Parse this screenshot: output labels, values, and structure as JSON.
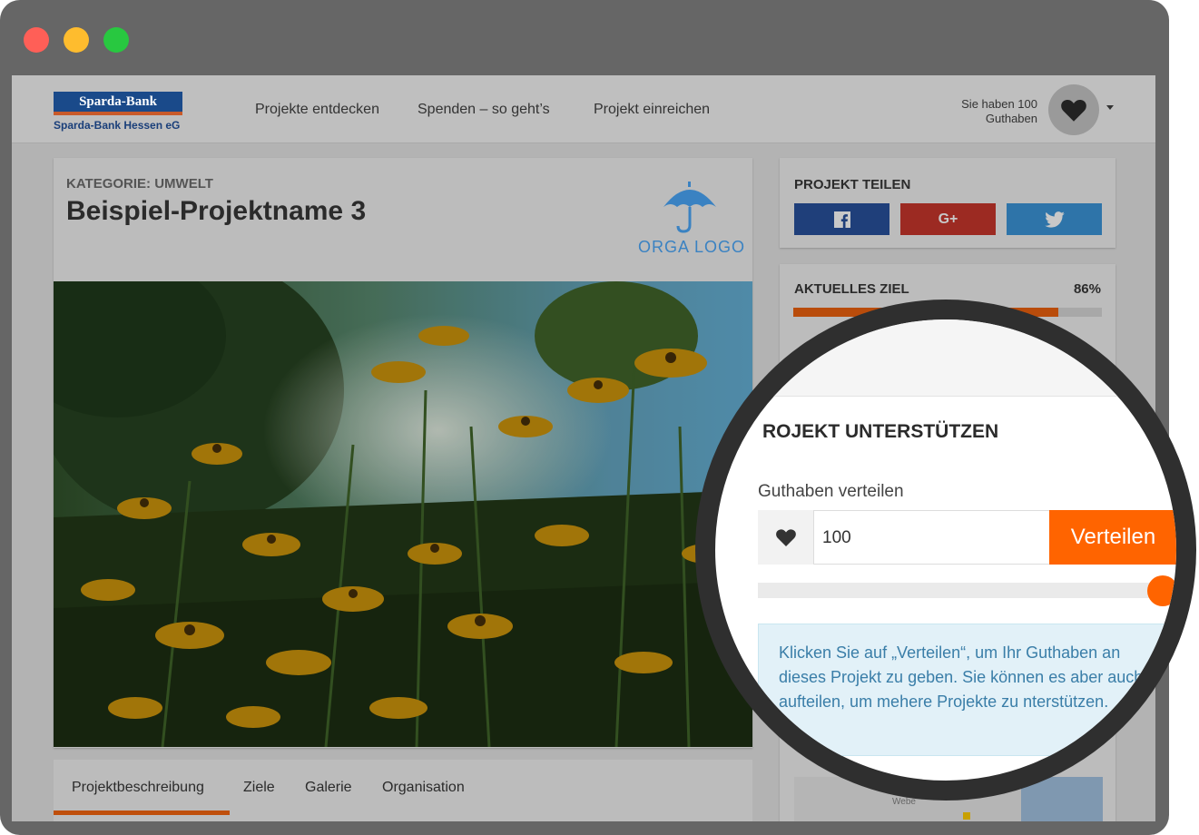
{
  "window": {
    "controls": [
      {
        "name": "close",
        "color": "#ff5f57"
      },
      {
        "name": "minimize",
        "color": "#febc2e"
      },
      {
        "name": "maximize",
        "color": "#28c840"
      }
    ]
  },
  "header": {
    "logo_title": "Sparda-Bank",
    "logo_subtitle": "Sparda-Bank Hessen eG",
    "nav": [
      "Projekte entdecken",
      "Spenden – so geht’s",
      "Projekt einreichen"
    ],
    "credit_line1": "Sie haben 100",
    "credit_line2": "Guthaben",
    "account_icon": "heart-icon"
  },
  "project": {
    "category": "KATEGORIE: UMWELT",
    "title": "Beispiel-Projektname 3",
    "orga_logo_text": "ORGA LOGO",
    "tabs": [
      "Projektbeschreibung",
      "Ziele",
      "Galerie",
      "Organisation"
    ],
    "active_tab": "Projektbeschreibung"
  },
  "sidebar": {
    "share_heading": "PROJEKT TEILEN",
    "share_buttons": [
      {
        "name": "facebook",
        "label": "f",
        "color": "#1f3f7a"
      },
      {
        "name": "google-plus",
        "label": "G+",
        "color": "#9c2a22"
      },
      {
        "name": "twitter",
        "label": "twitter",
        "color": "#2e74a9"
      }
    ],
    "goal_heading": "AKTUELLES ZIEL",
    "goal_percent_label": "86%",
    "goal_progress": 0.86,
    "map_label": "Webe"
  },
  "support": {
    "heading": "ROJEKT UNTERSTÜTZEN",
    "label": "Guthaben verteilen",
    "value": "100",
    "button": "Verteilen",
    "slider_value": 1.0,
    "info": "Klicken Sie auf „Verteilen“, um Ihr Guthaben an dieses Projekt zu geben. Sie können es aber auch aufteilen, um mehere Projekte zu nterstützen."
  },
  "colors": {
    "accent": "#ff6400",
    "brand_blue": "#1a4a8a"
  }
}
